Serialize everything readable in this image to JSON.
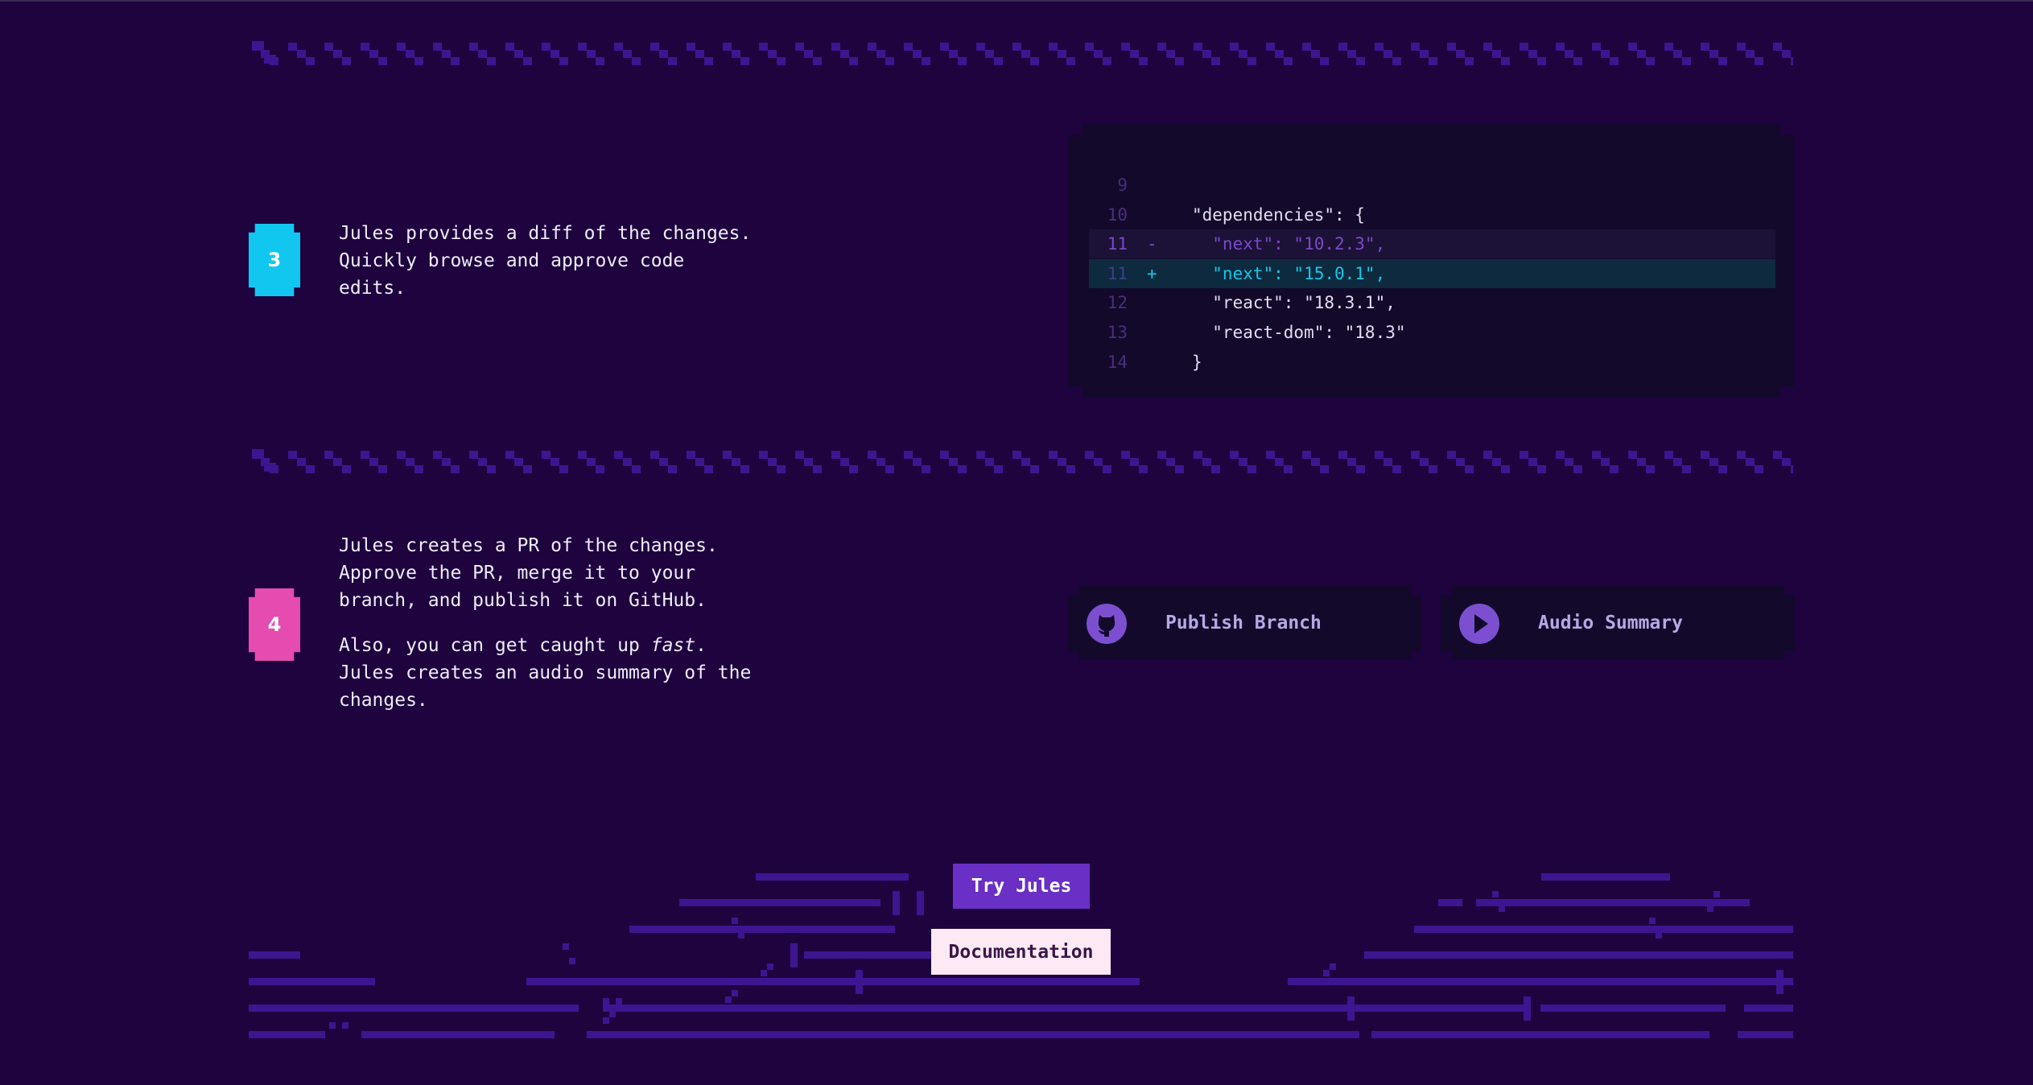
{
  "steps": [
    {
      "number": "3",
      "paragraphs": [
        "Jules provides a diff of the changes. Quickly browse and approve code edits."
      ]
    },
    {
      "number": "4",
      "paragraph1": "Jules creates a PR of the changes. Approve the PR, merge it to your branch, and publish it on GitHub.",
      "paragraph2_before": "Also, you can get caught up ",
      "paragraph2_em": "fast",
      "paragraph2_after": ". Jules creates an audio summary of the changes."
    }
  ],
  "code_diff": {
    "lines": [
      {
        "num": "9",
        "marker": "",
        "text": ""
      },
      {
        "num": "10",
        "marker": "",
        "text": "\"dependencies\": {"
      },
      {
        "num": "11",
        "marker": "-",
        "text": "  \"next\": \"10.2.3\","
      },
      {
        "num": "11",
        "marker": "+",
        "text": "  \"next\": \"15.0.1\","
      },
      {
        "num": "12",
        "marker": "",
        "text": "  \"react\": \"18.3.1\","
      },
      {
        "num": "13",
        "marker": "",
        "text": "  \"react-dom\": \"18.3\""
      },
      {
        "num": "14",
        "marker": "",
        "text": "}"
      }
    ]
  },
  "actions": {
    "publish_label": "Publish Branch",
    "publish_icon": "github-icon",
    "audio_label": "Audio Summary",
    "audio_icon": "play-icon"
  },
  "cta": {
    "try_label": "Try Jules",
    "docs_label": "Documentation"
  },
  "colors": {
    "background": "#1e033f",
    "step3_badge": "#11c7ef",
    "step4_badge": "#e64bb0",
    "primary_button": "#6a2fc4",
    "secondary_button": "#fde9f4",
    "added_line": "#16c8e6",
    "removed_line": "#7a49c7"
  }
}
